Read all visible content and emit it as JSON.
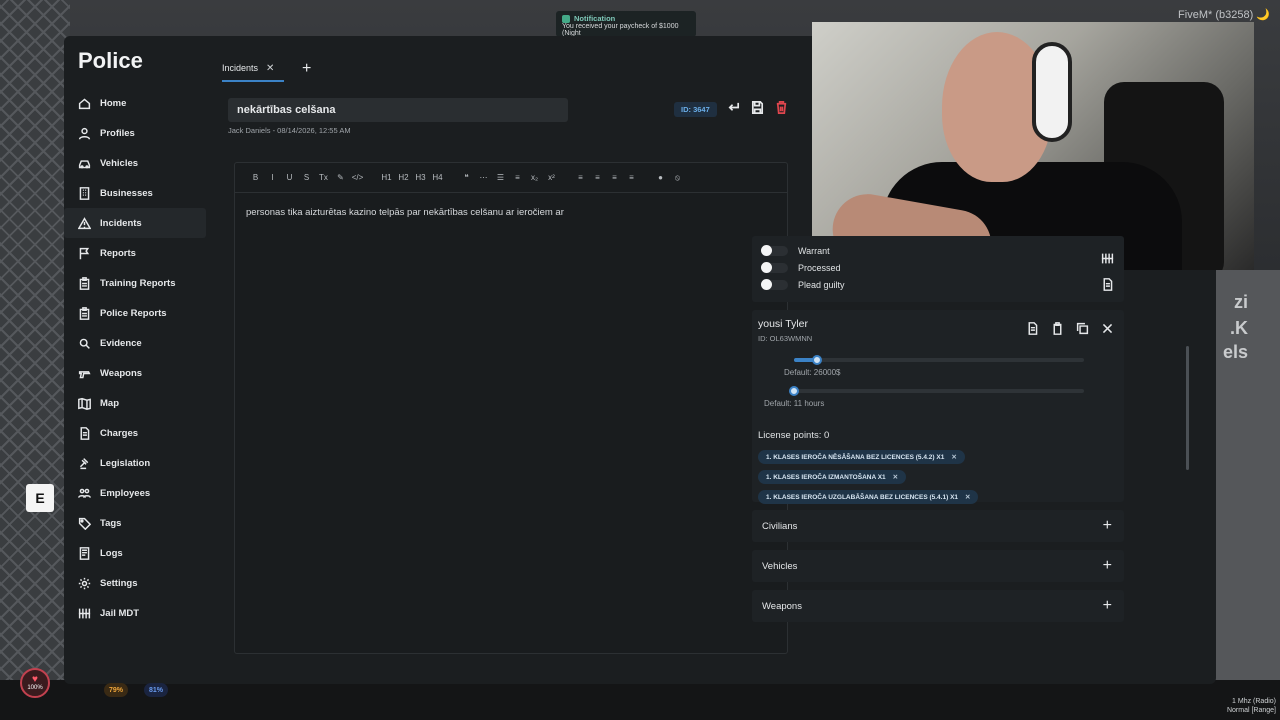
{
  "window": {
    "fivem_tag": "FiveM* (b3258) 🌙"
  },
  "notification": {
    "title": "Notification",
    "message": "You received your paycheck of $1000 (Night"
  },
  "sidebar": {
    "brand": "Police",
    "items": [
      {
        "label": "Home",
        "icon": "home-icon"
      },
      {
        "label": "Profiles",
        "icon": "user-icon"
      },
      {
        "label": "Vehicles",
        "icon": "car-icon"
      },
      {
        "label": "Businesses",
        "icon": "building-icon"
      },
      {
        "label": "Incidents",
        "icon": "warning-icon",
        "active": true
      },
      {
        "label": "Reports",
        "icon": "flag-icon"
      },
      {
        "label": "Training Reports",
        "icon": "clipboard-icon"
      },
      {
        "label": "Police Reports",
        "icon": "clipboard-icon"
      },
      {
        "label": "Evidence",
        "icon": "magnifier-icon"
      },
      {
        "label": "Weapons",
        "icon": "weapon-icon"
      },
      {
        "label": "Map",
        "icon": "map-icon"
      },
      {
        "label": "Charges",
        "icon": "document-icon"
      },
      {
        "label": "Legislation",
        "icon": "gavel-icon"
      },
      {
        "label": "Employees",
        "icon": "employees-icon"
      },
      {
        "label": "Tags",
        "icon": "tag-icon"
      },
      {
        "label": "Logs",
        "icon": "logs-icon"
      },
      {
        "label": "Settings",
        "icon": "gear-icon"
      },
      {
        "label": "Jail MDT",
        "icon": "jail-icon"
      }
    ]
  },
  "tabs": [
    {
      "label": "Incidents",
      "close": "✕"
    }
  ],
  "tab_add": "+",
  "incident": {
    "title": "nekārtības celšana",
    "meta": "Jack Daniels - 08/14/2026, 12:55 AM",
    "id_badge": "ID: 3647",
    "body": "personas tika aizturētas kazino telpās par nekārtības celšanu ar ieročiem ar"
  },
  "toolbar": [
    "B",
    "I",
    "U",
    "S",
    "Tx",
    "✎",
    "</>",
    "|",
    "H1",
    "H2",
    "H3",
    "H4",
    "|",
    "❝",
    "⋯",
    "☰",
    "≡",
    "x₂",
    "x²",
    "|",
    "≡",
    "≡",
    "≡",
    "≡",
    "|",
    "●",
    "⦸"
  ],
  "status": {
    "toggles": [
      "Warrant",
      "Processed",
      "Plead guilty"
    ]
  },
  "person": {
    "name": "yousi Tyler",
    "id": "ID: OL63WMNN",
    "fine_value": 0.08,
    "fine_label": "Default: 26000$",
    "jail_value": 0.0,
    "jail_label": "Default: 11 hours",
    "license_points": "License points: 0",
    "charges": [
      "1. KLASES IEROČA NĒSĀŠANA BEZ LICENCES (5.4.2) X1",
      "1. KLASES IEROČA IZMANTOŠANA X1",
      "1. KLASES IEROČA UZGLABĀŠANA BEZ LICENCES (5.4.1) X1"
    ]
  },
  "sections": [
    "Civilians",
    "Vehicles",
    "Weapons"
  ],
  "hud": {
    "key": "E",
    "health": "100%",
    "armor": "79%",
    "stamina": "81%",
    "radio_line1": "1 Mhz (Radio)",
    "radio_line2": "Normal [Range]"
  },
  "background_text": [
    "zi",
    ".K",
    "els"
  ],
  "colors": {
    "accent": "#3b82c6",
    "danger": "#e0464e",
    "id_badge": "#6aaee8"
  }
}
